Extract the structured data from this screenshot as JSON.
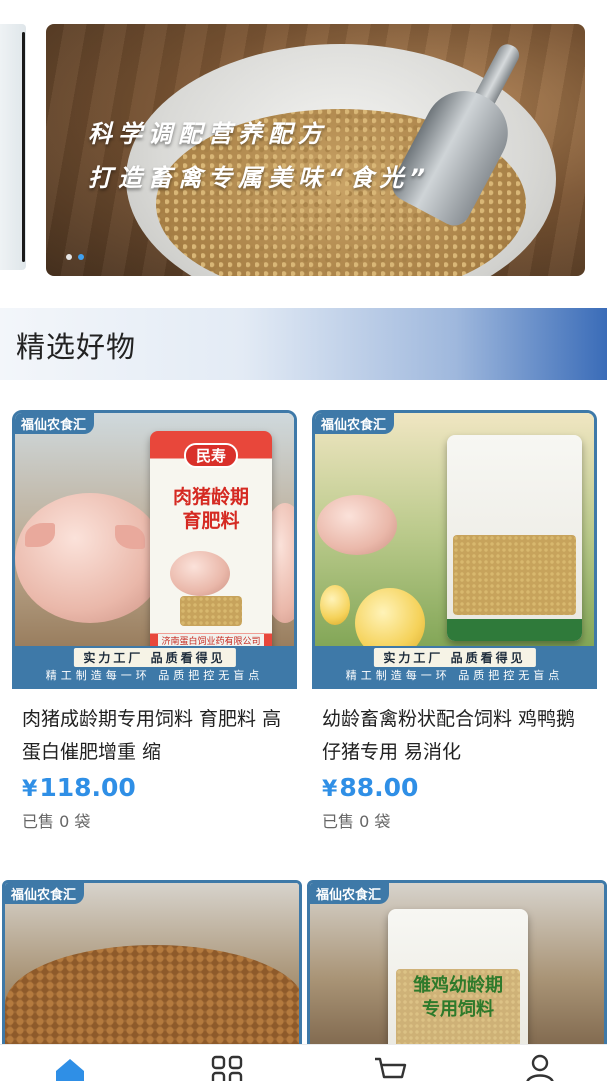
{
  "banner": {
    "line1": "科学调配营养配方",
    "line2": "打造畜禽专属美味“食光”",
    "dots": 2,
    "active_dot": 1
  },
  "section": {
    "title": "精选好物"
  },
  "products": [
    {
      "brand_tag": "福仙农食汇",
      "slogan_main": "实力工厂 品质看得见",
      "slogan_sub": "精工制造每一环 品质把控无盲点",
      "bag_logo": "民寿",
      "bag_title_1": "肉猪龄期",
      "bag_title_2": "育肥料",
      "bag_maker": "济南蛋白饲业药有限公司",
      "name": "肉猪成龄期专用饲料 育肥料 高蛋白催肥增重 缩",
      "currency": "¥",
      "price": "118.00",
      "sold": "已售 0 袋"
    },
    {
      "brand_tag": "福仙农食汇",
      "slogan_main": "实力工厂 品质看得见",
      "slogan_sub": "精工制造每一环 品质把控无盲点",
      "name": "幼龄畜禽粉状配合饲料 鸡鸭鹅仔猪专用 易消化",
      "currency": "¥",
      "price": "88.00",
      "sold": "已售 0 袋"
    },
    {
      "brand_tag": "福仙农食汇"
    },
    {
      "brand_tag": "福仙农食汇",
      "bag_title_1": "雏鸡幼龄期",
      "bag_title_2": "专用饲料"
    }
  ],
  "tabbar": {
    "items": [
      {
        "icon": "home-icon",
        "active": true
      },
      {
        "icon": "category-icon",
        "active": false
      },
      {
        "icon": "cart-icon",
        "active": false
      },
      {
        "icon": "user-icon",
        "active": false
      }
    ],
    "active_color": "#2f8fe6",
    "inactive_color": "#333333"
  },
  "colors": {
    "accent": "#2f8fe6",
    "card_border": "#3e79a8"
  }
}
